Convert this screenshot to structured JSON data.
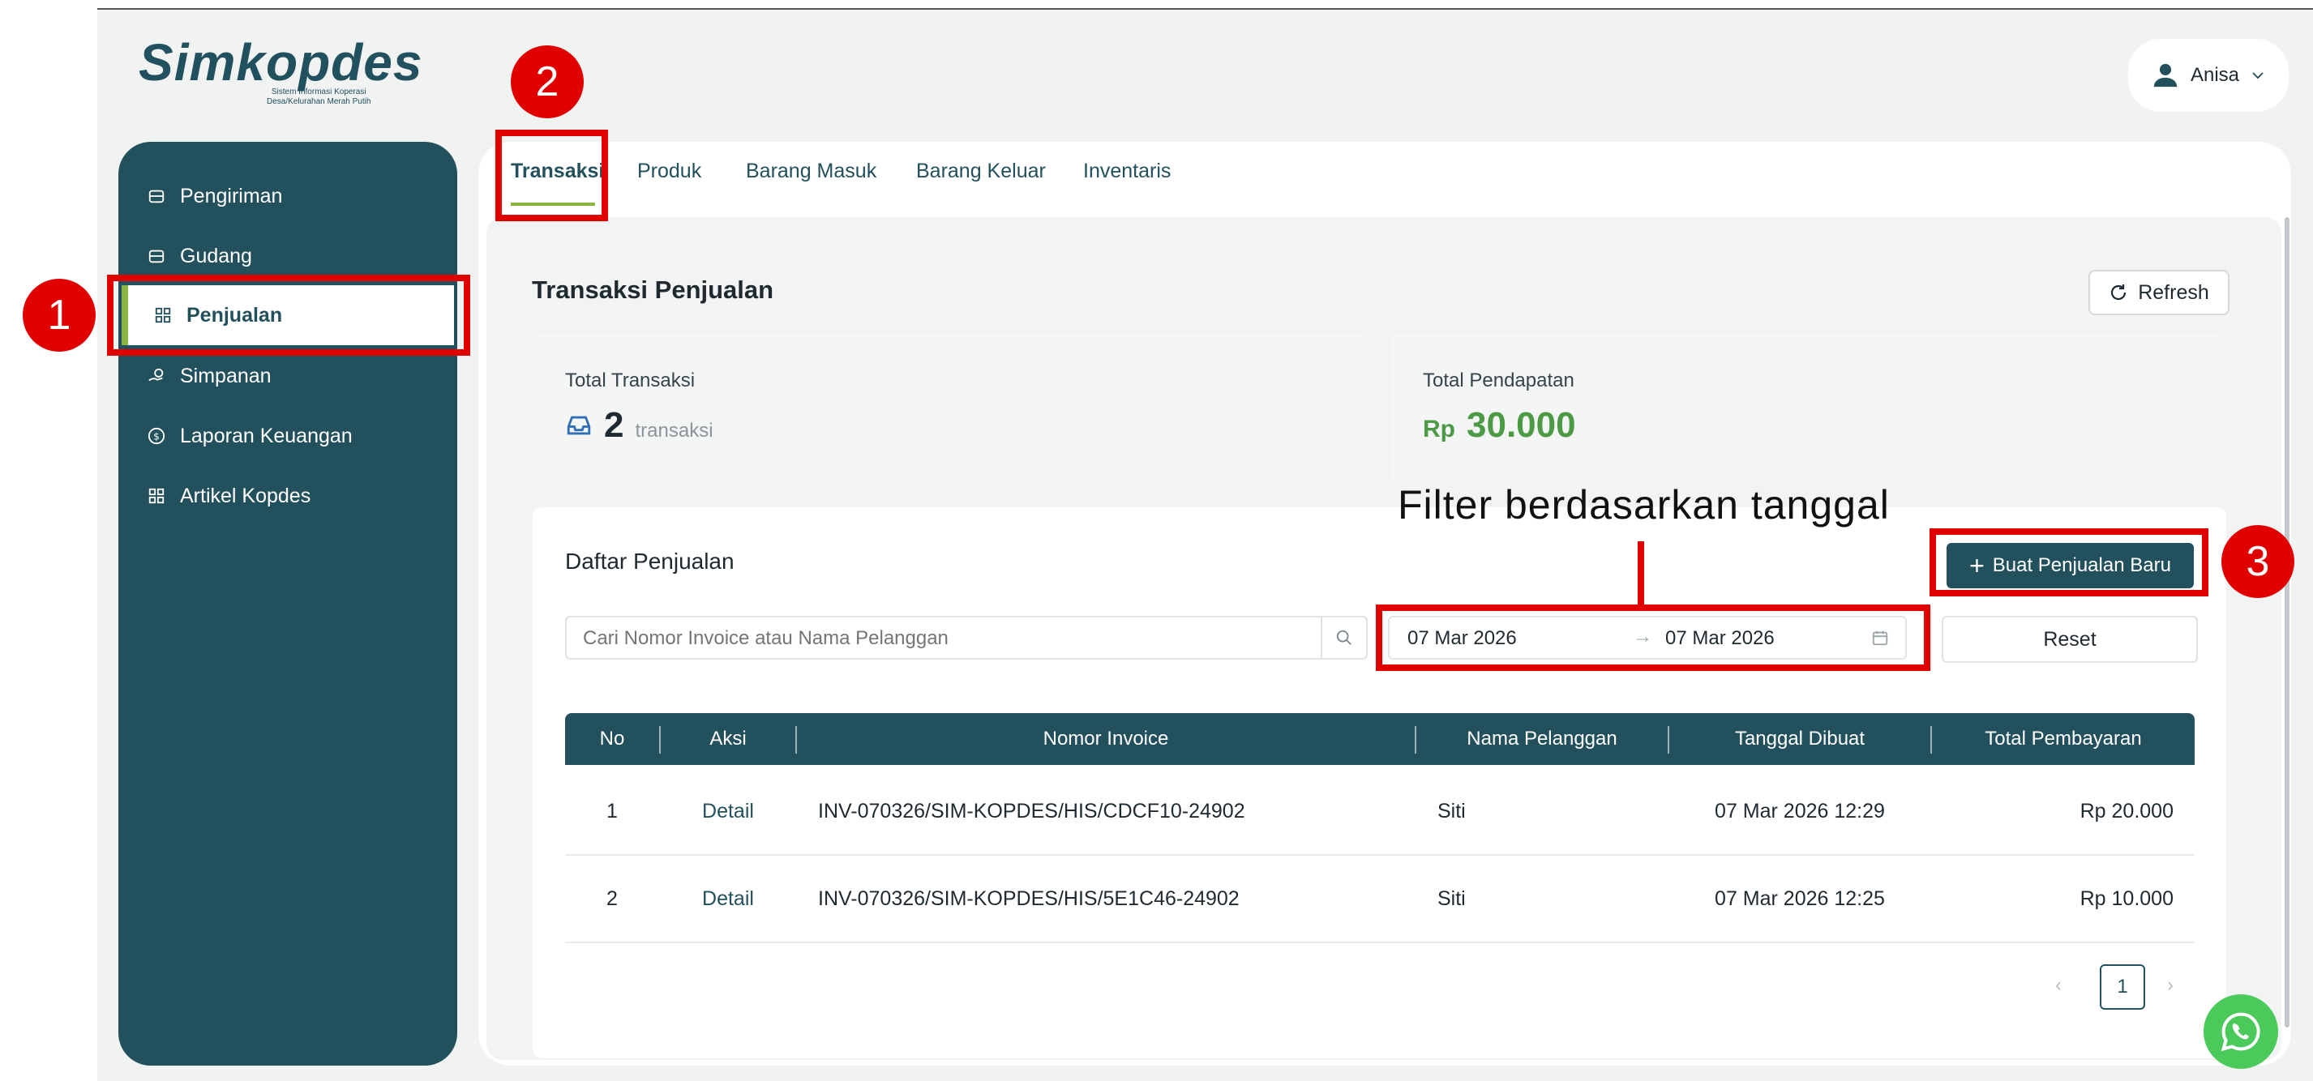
{
  "app": {
    "logo_text": "Simkopdes",
    "logo_subtitle_line1": "Sistem Informasi Koperasi",
    "logo_subtitle_line2": "Desa/Kelurahan Merah Putih",
    "user_name": "Anisa"
  },
  "sidebar": {
    "items": [
      {
        "label": "Pengiriman",
        "icon": "box-icon"
      },
      {
        "label": "Gudang",
        "icon": "box-icon"
      },
      {
        "label": "Penjualan",
        "icon": "grid-icon",
        "active": true
      },
      {
        "label": "Simpanan",
        "icon": "savings-icon"
      },
      {
        "label": "Laporan Keuangan",
        "icon": "dollar-circle-icon"
      },
      {
        "label": "Artikel Kopdes",
        "icon": "grid-icon"
      }
    ]
  },
  "tabs": [
    {
      "label": "Transaksi",
      "active": true
    },
    {
      "label": "Produk"
    },
    {
      "label": "Barang Masuk"
    },
    {
      "label": "Barang Keluar"
    },
    {
      "label": "Inventaris"
    }
  ],
  "page": {
    "title": "Transaksi Penjualan",
    "refresh_label": "Refresh"
  },
  "stats": {
    "total_transaksi_label": "Total Transaksi",
    "total_transaksi_value": "2",
    "total_transaksi_unit": "transaksi",
    "total_pendapatan_label": "Total Pendapatan",
    "total_pendapatan_currency": "Rp",
    "total_pendapatan_value": "30.000"
  },
  "list": {
    "title": "Daftar Penjualan",
    "new_button_label": "Buat Penjualan Baru",
    "search_placeholder": "Cari Nomor Invoice atau Nama Pelanggan",
    "date_start": "07 Mar 2026",
    "date_end": "07 Mar 2026",
    "reset_label": "Reset",
    "columns": [
      "No",
      "Aksi",
      "Nomor Invoice",
      "Nama Pelanggan",
      "Tanggal Dibuat",
      "Total Pembayaran"
    ],
    "rows": [
      {
        "no": "1",
        "aksi": "Detail",
        "invoice": "INV-070326/SIM-KOPDES/HIS/CDCF10-24902",
        "pelanggan": "Siti",
        "tanggal": "07 Mar 2026 12:29",
        "total": "Rp 20.000"
      },
      {
        "no": "2",
        "aksi": "Detail",
        "invoice": "INV-070326/SIM-KOPDES/HIS/5E1C46-24902",
        "pelanggan": "Siti",
        "tanggal": "07 Mar 2026 12:25",
        "total": "Rp 10.000"
      }
    ],
    "current_page": "1"
  },
  "annotations": {
    "badge1": "1",
    "badge2": "2",
    "badge3": "3",
    "filter_note": "Filter berdasarkan tanggal"
  },
  "colors": {
    "primary": "#23505d",
    "accent_green": "#8ab543",
    "revenue_green": "#4c9a45",
    "annotation_red": "#e10000"
  }
}
